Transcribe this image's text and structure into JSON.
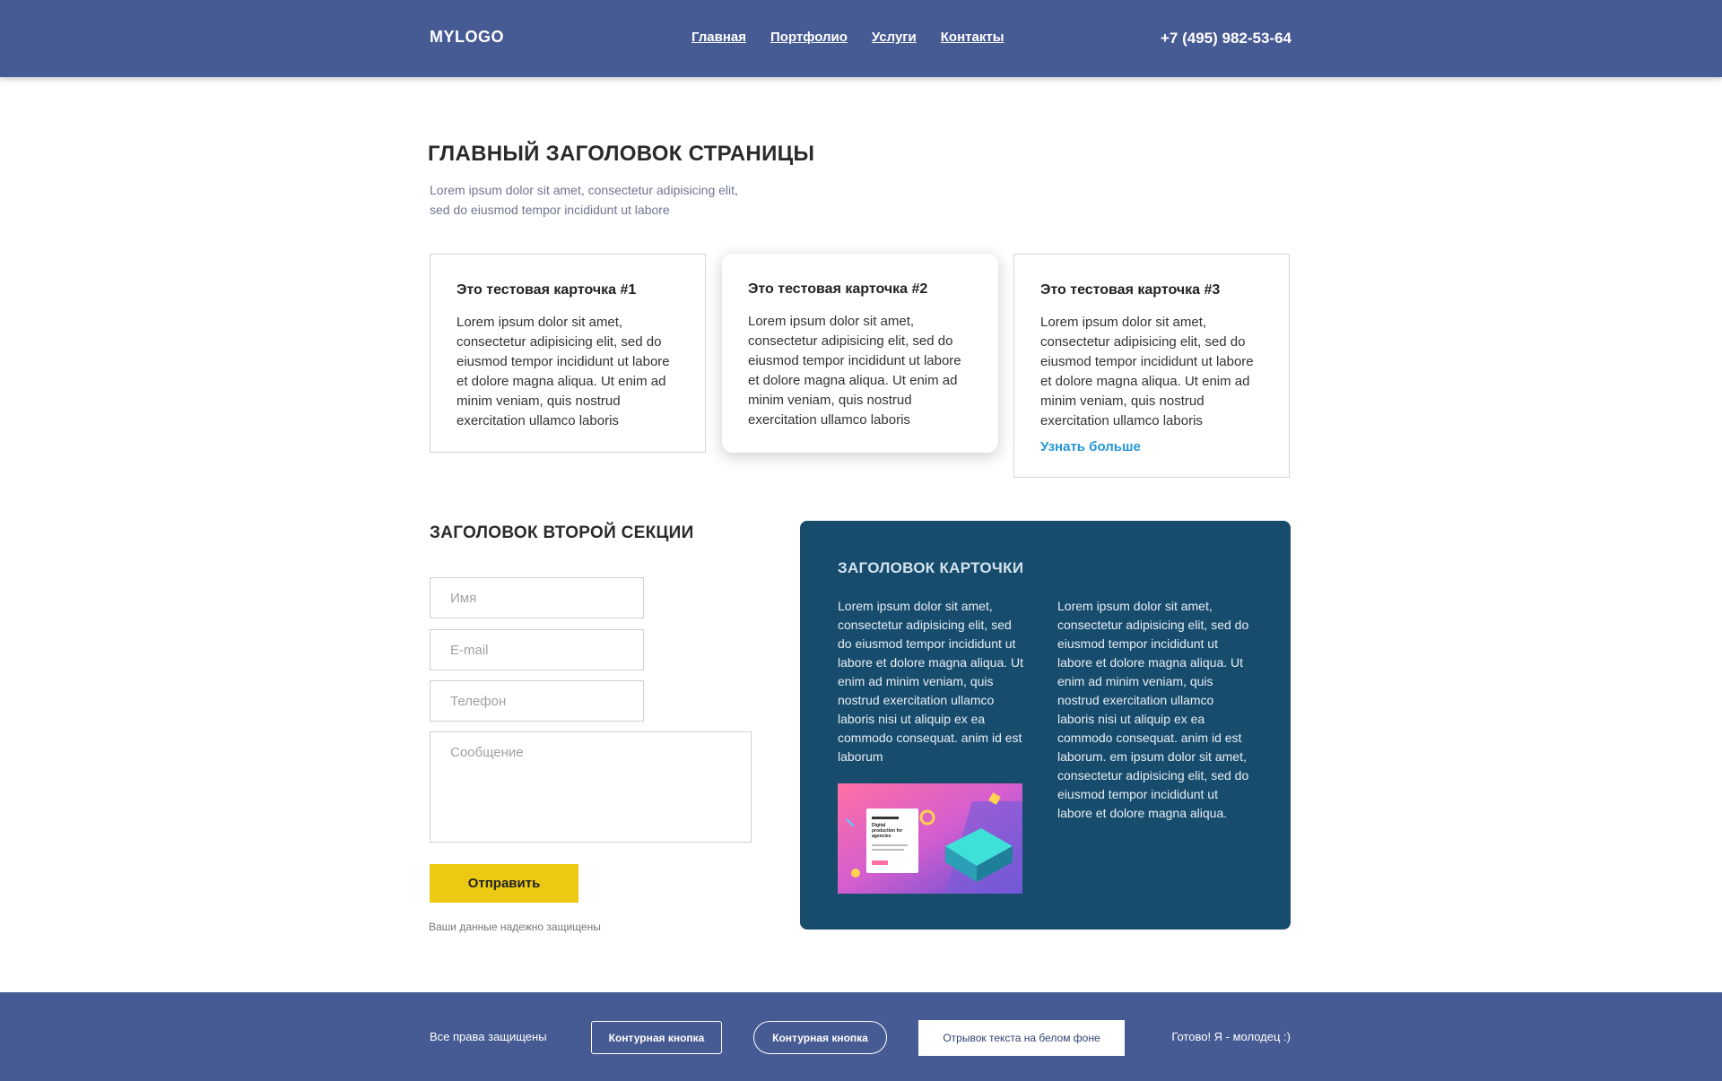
{
  "header": {
    "logo": "MYLOGO",
    "nav": [
      "Главная",
      "Портфолио",
      "Услуги",
      "Контакты"
    ],
    "phone": "+7 (495) 982-53-64"
  },
  "hero": {
    "title": "ГЛАВНЫЙ ЗАГОЛОВОК СТРАНИЦЫ",
    "subtitle": "Lorem ipsum dolor sit amet, consectetur adipisicing elit, sed do eiusmod tempor incididunt ut labore"
  },
  "cards": [
    {
      "title": "Это тестовая карточка #1",
      "text": "Lorem ipsum dolor sit amet, consectetur adipisicing elit, sed do eiusmod tempor incididunt ut labore et dolore magna aliqua. Ut enim ad minim veniam, quis nostrud exercitation ullamco laboris"
    },
    {
      "title": "Это тестовая карточка #2",
      "text": "Lorem ipsum dolor sit amet, consectetur adipisicing elit, sed do eiusmod tempor incididunt ut labore et dolore magna aliqua. Ut enim ad minim veniam, quis nostrud exercitation ullamco laboris"
    },
    {
      "title": "Это тестовая карточка #3",
      "text": "Lorem ipsum dolor sit amet, consectetur adipisicing elit, sed do eiusmod tempor incididunt ut labore et dolore magna aliqua. Ut enim ad minim veniam, quis nostrud exercitation ullamco laboris",
      "link": "Узнать больше"
    }
  ],
  "form": {
    "title": "ЗАГОЛОВОК ВТОРОЙ СЕКЦИИ",
    "name_placeholder": "Имя",
    "email_placeholder": "E-mail",
    "phone_placeholder": "Телефон",
    "message_placeholder": "Сообщение",
    "submit_label": "Отправить",
    "note": "Ваши данные надежно защищены"
  },
  "dark_card": {
    "title": "ЗАГОЛОВОК КАРТОЧКИ",
    "col1": "Lorem ipsum dolor sit amet, consectetur adipisicing elit, sed do eiusmod tempor incididunt ut labore et dolore magna aliqua. Ut enim ad minim veniam, quis nostrud exercitation ullamco laboris nisi ut aliquip ex ea commodo consequat. anim id est laborum",
    "col2": "Lorem ipsum dolor sit amet, consectetur adipisicing elit, sed do eiusmod tempor incididunt ut labore et dolore magna aliqua. Ut enim ad minim veniam, quis nostrud exercitation ullamco laboris nisi ut aliquip ex ea commodo consequat. anim id est laborum. em ipsum dolor sit amet, consectetur adipisicing elit, sed do eiusmod tempor incididunt ut labore et dolore magna aliqua.",
    "image_text": "Digital production for agencies"
  },
  "footer": {
    "copyright": "Все права защищены",
    "outline_btn_1": "Контурная кнопка",
    "outline_btn_2": "Контурная кнопка",
    "white_btn": "Отрывок текста на белом фоне",
    "right_text": "Готово! Я - молодец :)"
  },
  "colors": {
    "header_bg": "#465a93",
    "accent_yellow": "#ecca13",
    "dark_card_bg": "#184c6d",
    "link_blue": "#2597d8"
  }
}
